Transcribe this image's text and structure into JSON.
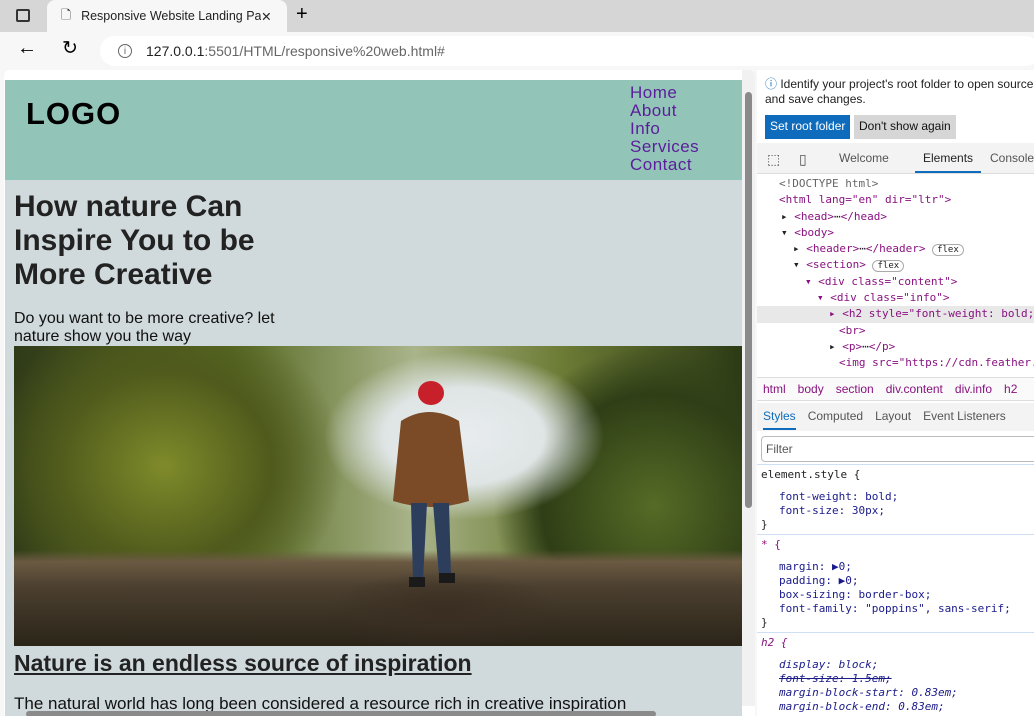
{
  "browser": {
    "tab_title": "Responsive Website Landing Page",
    "url_host": "127.0.0.1",
    "url_path": ":5501/HTML/responsive%20web.html#"
  },
  "page": {
    "logo": "LOGO",
    "nav": [
      "Home",
      "About",
      "Info",
      "Services",
      "Contact"
    ],
    "heading": "How nature Can Inspire You to be More Creative",
    "lead": "Do you want to be more creative? let nature show you the way",
    "subheading": "Nature is an endless source of inspiration",
    "paragraph": "The natural world has long been considered a resource rich in creative inspiration"
  },
  "devtools": {
    "banner": "Identify your project's root folder to open sources and save changes.",
    "set_root": "Set root folder",
    "dont_show": "Don't show again",
    "tabs": [
      "Welcome",
      "Elements",
      "Console"
    ],
    "active_tab": "Elements",
    "tree": [
      "<!DOCTYPE html>",
      "<html lang=\"en\" dir=\"ltr\">",
      "<head>",
      "</head>",
      "<body>",
      "<header>",
      "</header>",
      "flex",
      "<section>",
      "<div class=\"content\">",
      "<div class=\"info\">",
      "<h2 style=\"font-weight: bold;",
      "<br>",
      "<p>",
      "</p>",
      "<img src=\"https://cdn.feather."
    ],
    "breadcrumbs": [
      "html",
      "body",
      "section",
      "div.content",
      "div.info",
      "h2"
    ],
    "style_tabs": [
      "Styles",
      "Computed",
      "Layout",
      "Event Listeners"
    ],
    "filter_placeholder": "Filter",
    "rules": [
      {
        "selector": "element.style {",
        "props": [
          "font-weight: bold;",
          "font-size: 30px;"
        ]
      },
      {
        "selector": "* {",
        "props": [
          "margin: ▶0;",
          "padding: ▶0;",
          "box-sizing: border-box;",
          "font-family: \"poppins\", sans-serif;"
        ]
      },
      {
        "selector": "h2 {",
        "props": [
          "display: block;",
          "font-size: 1.5em;",
          "margin-block-start: 0.83em;",
          "margin-block-end: 0.83em;"
        ]
      }
    ],
    "close_brace": "}"
  },
  "colors": {
    "header_bg": "#92c5b8",
    "section_bg": "#d0d9db",
    "nav_link": "#5b1d9b",
    "accent": "#0f6cbd"
  }
}
